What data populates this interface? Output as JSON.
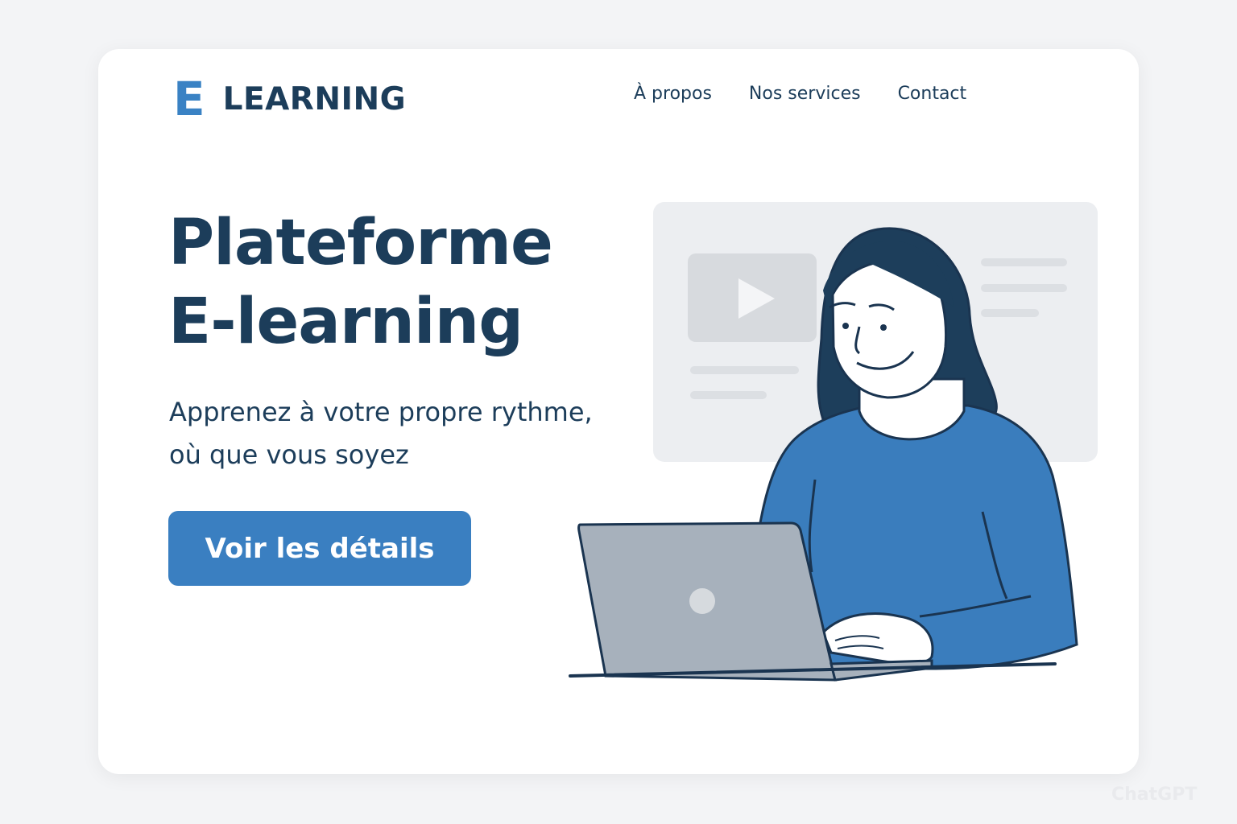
{
  "brand": {
    "mark": "E",
    "name": "LEARNING"
  },
  "nav": {
    "items": [
      "À propos",
      "Nos services",
      "Contact"
    ]
  },
  "hero": {
    "title_line1": "Plateforme",
    "title_line2": "E-learning",
    "subtitle_line1": "Apprenez à votre propre rythme,",
    "subtitle_line2": "où que vous soyez",
    "cta_label": "Voir les détails"
  },
  "illustration": {
    "subject": "woman-using-laptop",
    "icons": [
      "video-play-icon",
      "laptop-icon"
    ]
  },
  "watermark": "ChatGPT",
  "colors": {
    "background": "#f3f4f6",
    "card": "#ffffff",
    "primary_text": "#1c3d5a",
    "accent": "#3a7fc1",
    "panel": "#eceef1"
  }
}
